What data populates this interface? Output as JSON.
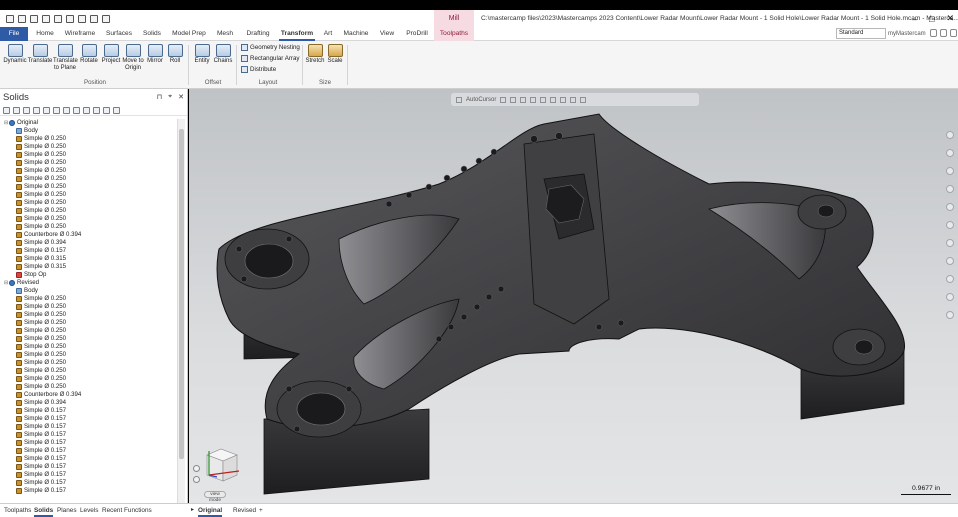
{
  "title_bar": {
    "context_tab": "Mill",
    "window_title": "C:\\mastercamp files\\2023\\Mastercamps 2023 Content\\Lower Radar Mount\\Lower Radar Mount - 1 Solid Hole\\Lower Radar Mount - 1 Solid Hole.mcam - Masterca...",
    "minimize": "–",
    "maximize": "□",
    "close": "✕"
  },
  "menu": {
    "tabs": [
      "File",
      "Home",
      "Wireframe",
      "Surfaces",
      "Solids",
      "Model Prep",
      "Mesh",
      "Drafting",
      "Transform",
      "Art",
      "Machine",
      "View",
      "ProDrill",
      "Toolpaths"
    ],
    "active": "Transform",
    "standard": "Standard",
    "my_mastercam": "myMastercam"
  },
  "ribbon": {
    "position_buttons": [
      "Dynamic",
      "Translate",
      "Translate to Plane",
      "Rotate",
      "Project",
      "Move to Origin",
      "Mirror",
      "Roll"
    ],
    "offset_buttons": [
      "Entity",
      "Chains"
    ],
    "layout_buttons": [
      "Geometry Nesting",
      "Rectangular Array",
      "Distribute"
    ],
    "size_buttons": [
      "Stretch",
      "Scale"
    ],
    "groups": {
      "position": "Position",
      "offset": "Offset",
      "layout": "Layout",
      "size": "Size"
    }
  },
  "panel": {
    "title": "Solids",
    "controls": {
      "pin": "⊓",
      "float": "⌖",
      "close": "✕"
    },
    "tree": [
      {
        "label": "Original",
        "kind": "group",
        "twisty": "⊟"
      },
      {
        "label": "Body",
        "kind": "body"
      },
      {
        "label": "Simple Ø 0.250",
        "kind": "op"
      },
      {
        "label": "Simple Ø 0.250",
        "kind": "op"
      },
      {
        "label": "Simple Ø 0.250",
        "kind": "op"
      },
      {
        "label": "Simple Ø 0.250",
        "kind": "op"
      },
      {
        "label": "Simple Ø 0.250",
        "kind": "op"
      },
      {
        "label": "Simple Ø 0.250",
        "kind": "op"
      },
      {
        "label": "Simple Ø 0.250",
        "kind": "op"
      },
      {
        "label": "Simple Ø 0.250",
        "kind": "op"
      },
      {
        "label": "Simple Ø 0.250",
        "kind": "op"
      },
      {
        "label": "Simple Ø 0.250",
        "kind": "op"
      },
      {
        "label": "Simple Ø 0.250",
        "kind": "op"
      },
      {
        "label": "Simple Ø 0.250",
        "kind": "op"
      },
      {
        "label": "Counterbore Ø 0.394",
        "kind": "op"
      },
      {
        "label": "Simple Ø 0.394",
        "kind": "op"
      },
      {
        "label": "Simple Ø 0.157",
        "kind": "op"
      },
      {
        "label": "Simple Ø 0.315",
        "kind": "op"
      },
      {
        "label": "Simple Ø 0.315",
        "kind": "op"
      },
      {
        "label": "Stop Op",
        "kind": "stop"
      },
      {
        "label": "Revised",
        "kind": "group",
        "twisty": "⊟"
      },
      {
        "label": "Body",
        "kind": "body"
      },
      {
        "label": "Simple Ø 0.250",
        "kind": "op"
      },
      {
        "label": "Simple Ø 0.250",
        "kind": "op"
      },
      {
        "label": "Simple Ø 0.250",
        "kind": "op"
      },
      {
        "label": "Simple Ø 0.250",
        "kind": "op"
      },
      {
        "label": "Simple Ø 0.250",
        "kind": "op"
      },
      {
        "label": "Simple Ø 0.250",
        "kind": "op"
      },
      {
        "label": "Simple Ø 0.250",
        "kind": "op"
      },
      {
        "label": "Simple Ø 0.250",
        "kind": "op"
      },
      {
        "label": "Simple Ø 0.250",
        "kind": "op"
      },
      {
        "label": "Simple Ø 0.250",
        "kind": "op"
      },
      {
        "label": "Simple Ø 0.250",
        "kind": "op"
      },
      {
        "label": "Simple Ø 0.250",
        "kind": "op"
      },
      {
        "label": "Counterbore Ø 0.394",
        "kind": "op"
      },
      {
        "label": "Simple Ø 0.394",
        "kind": "op"
      },
      {
        "label": "Simple Ø 0.157",
        "kind": "op"
      },
      {
        "label": "Simple Ø 0.157",
        "kind": "op"
      },
      {
        "label": "Simple Ø 0.157",
        "kind": "op"
      },
      {
        "label": "Simple Ø 0.157",
        "kind": "op"
      },
      {
        "label": "Simple Ø 0.157",
        "kind": "op"
      },
      {
        "label": "Simple Ø 0.157",
        "kind": "op"
      },
      {
        "label": "Simple Ø 0.157",
        "kind": "op"
      },
      {
        "label": "Simple Ø 0.157",
        "kind": "op"
      },
      {
        "label": "Simple Ø 0.157",
        "kind": "op"
      },
      {
        "label": "Simple Ø 0.157",
        "kind": "op"
      },
      {
        "label": "Simple Ø 0.157",
        "kind": "op"
      }
    ]
  },
  "viewport": {
    "toolbar_label": "AutoCursor",
    "scale": "0.9677 in",
    "view_pill": "view mode"
  },
  "status": {
    "left_tabs": [
      "Toolpaths",
      "Solids",
      "Planes",
      "Levels",
      "Recent Functions"
    ],
    "left_active": "Solids",
    "view_sheets": [
      "Original",
      "Revised"
    ],
    "view_active": "Original",
    "add_sheet": "+"
  }
}
